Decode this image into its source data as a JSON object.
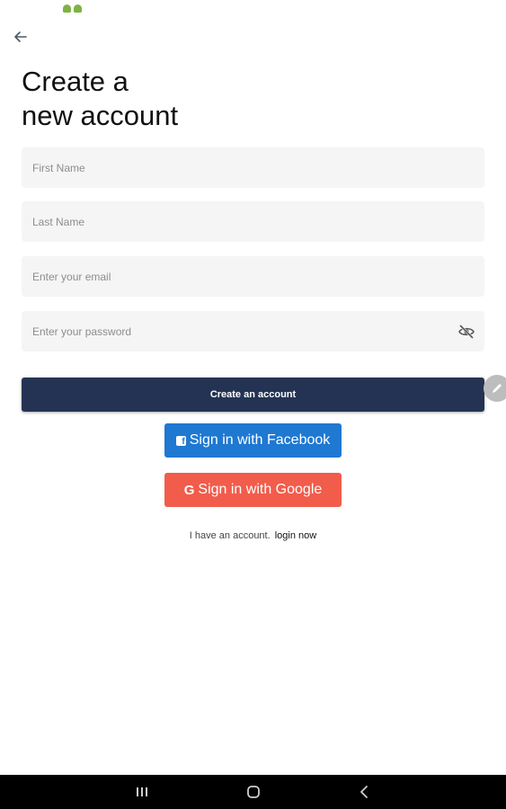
{
  "header": {
    "title_line1": "Create a",
    "title_line2": "new account"
  },
  "form": {
    "first_name": {
      "placeholder": "First Name",
      "value": ""
    },
    "last_name": {
      "placeholder": "Last Name",
      "value": ""
    },
    "email": {
      "placeholder": "Enter your email",
      "value": ""
    },
    "password": {
      "placeholder": "Enter your password",
      "value": ""
    }
  },
  "buttons": {
    "create_account": "Create an account",
    "facebook": "Sign in with Facebook",
    "google": "Sign in with Google",
    "google_icon_glyph": "G"
  },
  "footer": {
    "have_account": "I have an account.",
    "login_now": "login now"
  },
  "icons": {
    "back": "arrow-left-icon",
    "password_visibility": "eye-off-icon",
    "edit": "pencil-icon",
    "facebook": "facebook-icon",
    "google": "google-icon",
    "nav_recents": "recents-icon",
    "nav_home": "home-icon",
    "nav_back": "back-chevron-icon"
  },
  "colors": {
    "primary_button": "#243353",
    "facebook": "#1f78d1",
    "google": "#f25c4b",
    "field_background": "#f5f5f5"
  }
}
